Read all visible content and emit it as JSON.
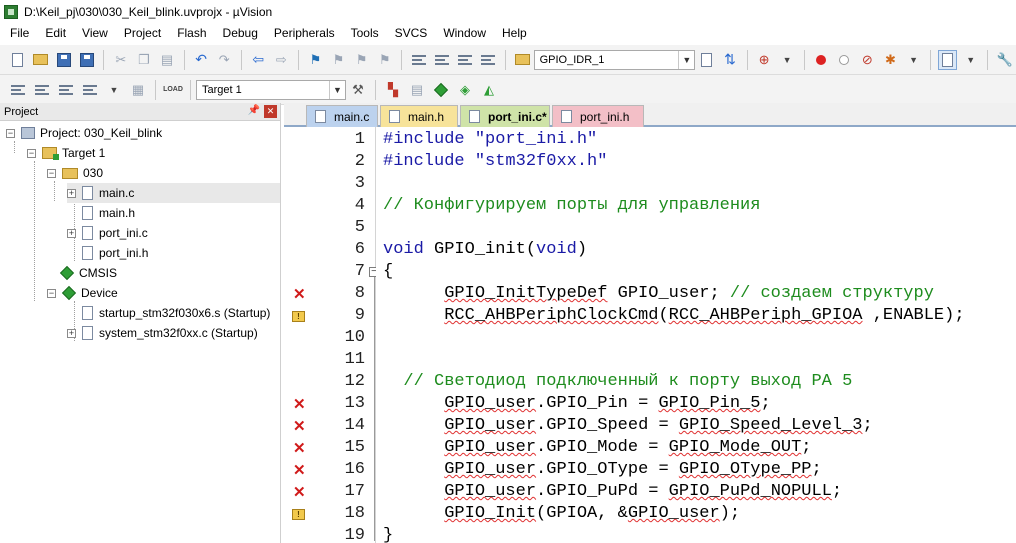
{
  "window": {
    "title": "D:\\Keil_pj\\030\\030_Keil_blink.uvprojx - µVision"
  },
  "menu": [
    "File",
    "Edit",
    "View",
    "Project",
    "Flash",
    "Debug",
    "Peripherals",
    "Tools",
    "SVCS",
    "Window",
    "Help"
  ],
  "toolbar": {
    "find_value": "GPIO_IDR_1",
    "target_value": "Target 1"
  },
  "project": {
    "title": "Project",
    "root": "Project: 030_Keil_blink",
    "target": "Target 1",
    "group": "030",
    "files": [
      "main.c",
      "main.h",
      "port_ini.c",
      "port_ini.h"
    ],
    "cmsis": "CMSIS",
    "device": "Device",
    "device_files": [
      "startup_stm32f030x6.s (Startup)",
      "system_stm32f0xx.c (Startup)"
    ]
  },
  "tabs": [
    "main.c",
    "main.h",
    "port_ini.c*",
    "port_ini.h"
  ],
  "editor": {
    "lines": [
      {
        "n": "1",
        "mark": "",
        "segments": [
          [
            "kw",
            "#include "
          ],
          [
            "str",
            "\"port_ini.h\""
          ]
        ]
      },
      {
        "n": "2",
        "mark": "",
        "segments": [
          [
            "kw",
            "#include "
          ],
          [
            "str",
            "\"stm32f0xx.h\""
          ]
        ]
      },
      {
        "n": "3",
        "mark": "",
        "segments": []
      },
      {
        "n": "4",
        "mark": "",
        "segments": [
          [
            "cmt",
            "// Конфигурируем порты для управления"
          ]
        ]
      },
      {
        "n": "5",
        "mark": "",
        "segments": []
      },
      {
        "n": "6",
        "mark": "",
        "segments": [
          [
            "kw",
            "void"
          ],
          [
            "",
            " GPIO_init("
          ],
          [
            "kw",
            "void"
          ],
          [
            "",
            ")"
          ]
        ]
      },
      {
        "n": "7",
        "mark": "",
        "segments": [
          [
            "",
            "{"
          ]
        ]
      },
      {
        "n": "8",
        "mark": "error",
        "segments": [
          [
            "",
            "      "
          ],
          [
            "err",
            "GPIO_InitTypeDef"
          ],
          [
            "",
            " GPIO_user; "
          ],
          [
            "cmt",
            "// создаем структуру"
          ]
        ]
      },
      {
        "n": "9",
        "mark": "warning",
        "segments": [
          [
            "",
            "      "
          ],
          [
            "err",
            "RCC_AHBPeriphClockCmd"
          ],
          [
            "",
            "("
          ],
          [
            "err",
            "RCC_AHBPeriph_GPIOA"
          ],
          [
            "",
            " ,ENABLE);"
          ]
        ]
      },
      {
        "n": "10",
        "mark": "",
        "segments": []
      },
      {
        "n": "11",
        "mark": "",
        "segments": []
      },
      {
        "n": "12",
        "mark": "",
        "segments": [
          [
            "",
            "  "
          ],
          [
            "cmt",
            "// Светодиод подключенный к порту выход PA 5"
          ]
        ]
      },
      {
        "n": "13",
        "mark": "error",
        "segments": [
          [
            "",
            "      "
          ],
          [
            "err",
            "GPIO_user"
          ],
          [
            "",
            ".GPIO_Pin = "
          ],
          [
            "err",
            "GPIO_Pin_5"
          ],
          [
            "",
            ";"
          ]
        ]
      },
      {
        "n": "14",
        "mark": "error",
        "segments": [
          [
            "",
            "      "
          ],
          [
            "err",
            "GPIO_user"
          ],
          [
            "",
            ".GPIO_Speed = "
          ],
          [
            "err",
            "GPIO_Speed_Level_3"
          ],
          [
            "",
            ";"
          ]
        ]
      },
      {
        "n": "15",
        "mark": "error",
        "segments": [
          [
            "",
            "      "
          ],
          [
            "err",
            "GPIO_user"
          ],
          [
            "",
            ".GPIO_Mode = "
          ],
          [
            "err",
            "GPIO_Mode_OUT"
          ],
          [
            "",
            ";"
          ]
        ]
      },
      {
        "n": "16",
        "mark": "error",
        "segments": [
          [
            "",
            "      "
          ],
          [
            "err",
            "GPIO_user"
          ],
          [
            "",
            ".GPIO_OType = "
          ],
          [
            "err",
            "GPIO_OType_PP"
          ],
          [
            "",
            ";"
          ]
        ]
      },
      {
        "n": "17",
        "mark": "error",
        "segments": [
          [
            "",
            "      "
          ],
          [
            "err",
            "GPIO_user"
          ],
          [
            "",
            ".GPIO_PuPd = "
          ],
          [
            "err",
            "GPIO_PuPd_NOPULL"
          ],
          [
            "",
            ";"
          ]
        ]
      },
      {
        "n": "18",
        "mark": "warning",
        "segments": [
          [
            "",
            "      "
          ],
          [
            "err",
            "GPIO_Init"
          ],
          [
            "",
            "(GPIOA, &"
          ],
          [
            "err",
            "GPIO_user"
          ],
          [
            "",
            ");"
          ]
        ]
      },
      {
        "n": "19",
        "mark": "",
        "segments": [
          [
            "",
            "}"
          ]
        ]
      }
    ]
  },
  "colors": {
    "keyword": "#1a1aa6",
    "comment": "#1e8c1e",
    "error_mark": "#d01a1a",
    "warning_mark": "#f2c94c"
  }
}
